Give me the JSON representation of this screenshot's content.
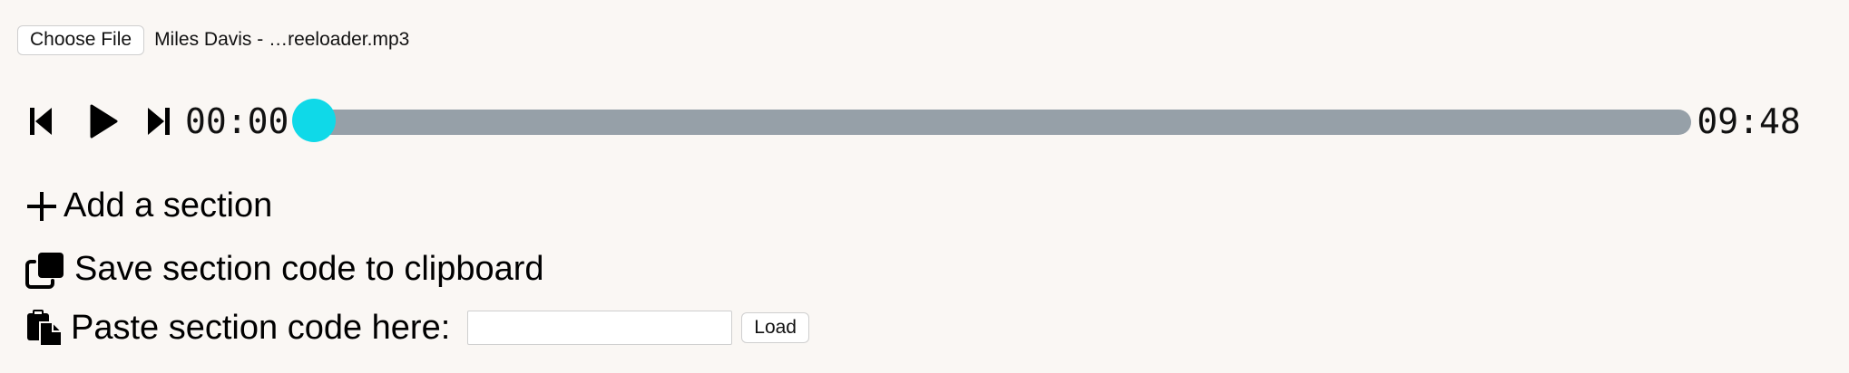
{
  "file_input": {
    "button_label": "Choose File",
    "file_name": "Miles Davis - …reeloader.mp3"
  },
  "player": {
    "prev_icon": "skip-previous-icon",
    "play_icon": "play-icon",
    "next_icon": "skip-next-icon",
    "current_time": "00:00",
    "total_time": "09:48",
    "progress": 0,
    "colors": {
      "track": "#96a0a8",
      "thumb": "#0fd9e8"
    }
  },
  "actions": {
    "add_section": {
      "icon": "plus-icon",
      "label": "Add a section"
    },
    "save_section": {
      "icon": "copy-icon",
      "label": "Save section code to clipboard"
    },
    "paste_section": {
      "icon": "paste-icon",
      "label": "Paste section code here:",
      "input_value": "",
      "load_label": "Load"
    }
  }
}
